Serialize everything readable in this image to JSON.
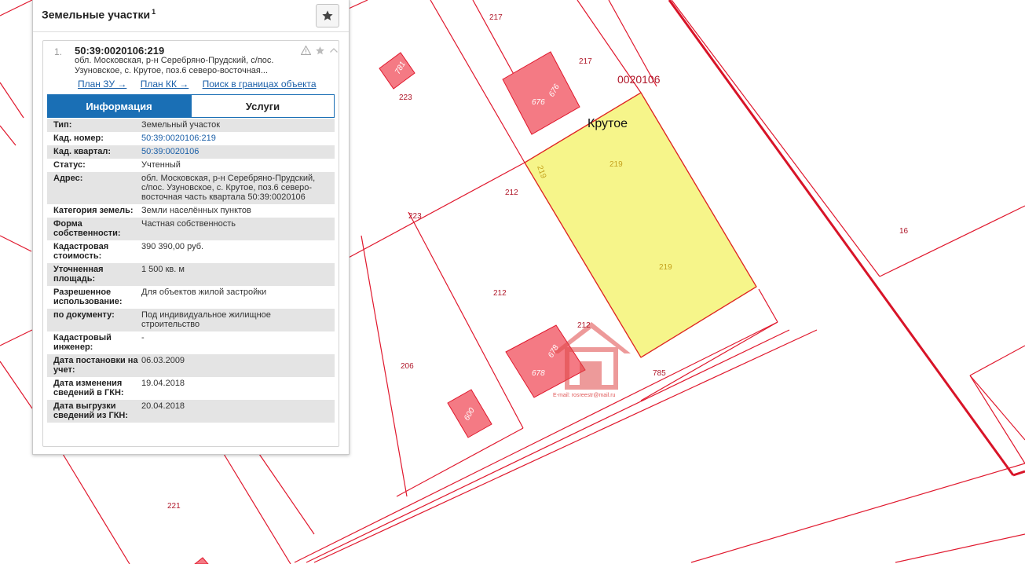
{
  "panel": {
    "title": "Земельные участки",
    "count": "1",
    "item": {
      "index": "1.",
      "cad_number": "50:39:0020106:219",
      "address_short": "обл. Московская, р-н Серебряно-Прудский, с/пос. Узуновское, с. Крутое, поз.6 северо-восточная...",
      "links": [
        "План ЗУ →",
        "План КК →",
        "Поиск в границах объекта →"
      ],
      "tabs": [
        "Информация",
        "Услуги"
      ],
      "attributes": [
        {
          "label": "Тип:",
          "value": "Земельный участок"
        },
        {
          "label": "Кад. номер:",
          "value": "50:39:0020106:219",
          "link": true
        },
        {
          "label": "Кад. квартал:",
          "value": "50:39:0020106",
          "link": true
        },
        {
          "label": "Статус:",
          "value": "Учтенный"
        },
        {
          "label": "Адрес:",
          "value": "обл. Московская, р-н Серебряно-Прудский, с/пос. Узуновское, с. Крутое, поз.6 северо-восточная часть квартала 50:39:0020106"
        },
        {
          "label": "Категория земель:",
          "value": "Земли населённых пунктов"
        },
        {
          "label": "Форма собственности:",
          "value": "Частная собственность"
        },
        {
          "label": "Кадастровая стоимость:",
          "value": "390 390,00 руб."
        },
        {
          "label": "Уточненная площадь:",
          "value": "1 500 кв. м"
        },
        {
          "label": "Разрешенное использование:",
          "value": "Для объектов жилой застройки"
        },
        {
          "label": "по документу:",
          "value": "Под индивидуальное жилищное строительство"
        },
        {
          "label": "Кадастровый инженер:",
          "value": "-"
        },
        {
          "label": "Дата постановки на учет:",
          "value": "06.03.2009"
        },
        {
          "label": "Дата изменения сведений в ГКН:",
          "value": "19.04.2018"
        },
        {
          "label": "Дата выгрузки сведений из ГКН:",
          "value": "20.04.2018"
        }
      ]
    }
  },
  "map": {
    "quarter_label": "0020106",
    "settlement": "Крутое",
    "selected_parcel": "219",
    "parcel_labels": [
      "217",
      "217",
      "223",
      "223",
      "212",
      "212",
      "212",
      "16",
      "206",
      "785",
      "221",
      "219",
      "219",
      "219"
    ],
    "building_labels": [
      "781",
      "676",
      "676",
      "678",
      "678",
      "600"
    ],
    "watermark_email": "E-mail: rosreestr@mail.ru",
    "colors": {
      "boundary": "#e0182d",
      "building_fill": "#f47a84",
      "selected_fill": "#f6f58a",
      "selected_border": "#e8c640"
    }
  },
  "icons": {
    "favorite": "star-icon",
    "warning": "warning-icon",
    "card_favorite": "star-outline-icon",
    "collapse": "chevron-up-icon"
  }
}
